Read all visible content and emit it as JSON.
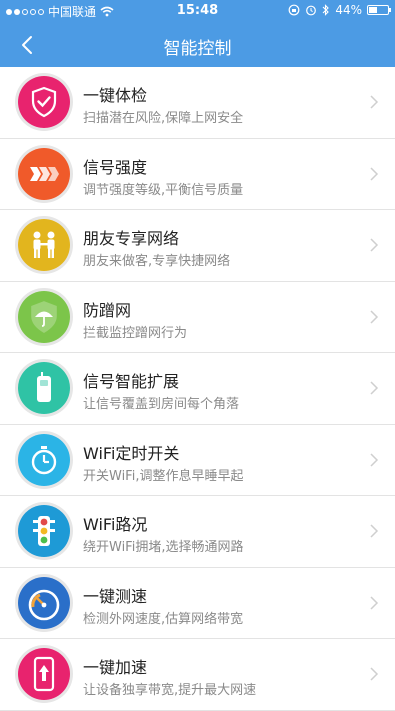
{
  "status": {
    "carrier": "中国联通",
    "time": "15:48",
    "battery": "44%",
    "battery_level": 0.44
  },
  "nav": {
    "title": "智能控制",
    "back_icon": "chevron-left-icon"
  },
  "items": [
    {
      "title": "一键体检",
      "desc": "扫描潜在风险,保障上网安全",
      "icon": "shield-check-icon",
      "color": "#e8236e"
    },
    {
      "title": "信号强度",
      "desc": "调节强度等级,平衡信号质量",
      "icon": "signal-chevrons-icon",
      "color": "#f05a2a"
    },
    {
      "title": "朋友专享网络",
      "desc": "朋友来做客,专享快捷网络",
      "icon": "friends-icon",
      "color": "#e2b51e"
    },
    {
      "title": "防蹭网",
      "desc": "拦截监控蹭网行为",
      "icon": "umbrella-shield-icon",
      "color": "#7cc54a"
    },
    {
      "title": "信号智能扩展",
      "desc": "让信号覆盖到房间每个角落",
      "icon": "extender-icon",
      "color": "#2fc3a5"
    },
    {
      "title": "WiFi定时开关",
      "desc": "开关WiFi,调整作息早睡早起",
      "icon": "stopwatch-icon",
      "color": "#2bb4e6"
    },
    {
      "title": "WiFi路况",
      "desc": "绕开WiFi拥堵,选择畅通网路",
      "icon": "traffic-light-icon",
      "color": "#1e9ad6"
    },
    {
      "title": "一键测速",
      "desc": "检测外网速度,估算网络带宽",
      "icon": "speedometer-icon",
      "color": "#2a6fc9"
    },
    {
      "title": "一键加速",
      "desc": "让设备独享带宽,提升最大网速",
      "icon": "phone-boost-icon",
      "color": "#e8236e"
    }
  ]
}
